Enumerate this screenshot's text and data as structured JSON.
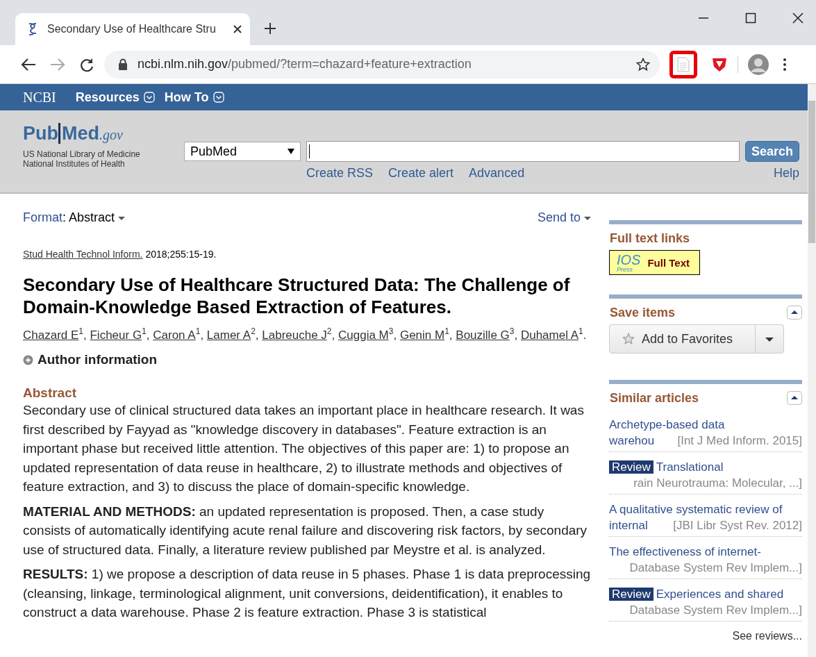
{
  "browser": {
    "tab": {
      "title": "Secondary Use of Healthcare Stru",
      "selected": true
    },
    "url_host": "ncbi.nlm.nih.gov",
    "url_path": "/pubmed/?term=chazard+feature+extraction",
    "extension_highlighted": true
  },
  "ncbi_bar": {
    "logo": "NCBI",
    "menus": [
      "Resources",
      "How To"
    ]
  },
  "header": {
    "logo_pub": "Pub",
    "logo_med": "Med",
    "logo_gov": ".gov",
    "org_lines": [
      "US National Library of Medicine",
      "National Institutes of Health"
    ],
    "database": "PubMed",
    "search_button": "Search",
    "links": [
      "Create RSS",
      "Create alert",
      "Advanced"
    ],
    "help": "Help"
  },
  "format": {
    "label": "Format",
    "separator": ":",
    "value": "Abstract"
  },
  "send_to": "Send to",
  "citation": {
    "journal": "Stud Health Technol Inform.",
    "details": "2018;255:15-19."
  },
  "title": "Secondary Use of Healthcare Structured Data: The Challenge of Domain-Knowledge Based Extraction of Features.",
  "authors": [
    {
      "name": "Chazard E",
      "affil": "1",
      "sep": ","
    },
    {
      "name": "Ficheur G",
      "affil": "1",
      "sep": ","
    },
    {
      "name": "Caron A",
      "affil": "1",
      "sep": ","
    },
    {
      "name": "Lamer A",
      "affil": "2",
      "sep": ","
    },
    {
      "name": "Labreuche J",
      "affil": "2",
      "sep": ","
    },
    {
      "name": "Cuggia M",
      "affil": "3",
      "sep": ","
    },
    {
      "name": "Genin M",
      "affil": "1",
      "sep": ","
    },
    {
      "name": "Bouzille G",
      "affil": "3",
      "sep": ","
    },
    {
      "name": "Duhamel A",
      "affil": "1",
      "sep": "."
    }
  ],
  "author_info": {
    "label": "Author information",
    "expanded": false
  },
  "abstract": {
    "heading": "Abstract",
    "paragraphs": [
      "Secondary use of clinical structured data takes an important place in healthcare research. It was first described by Fayyad as \"knowledge discovery in databases\". Feature extraction is an important phase but received little attention. The objectives of this paper are: 1) to propose an updated representation of data reuse in healthcare, 2) to illustrate methods and objectives of feature extraction, and 3) to discuss the place of domain-specific knowledge.",
      "**MATERIAL AND METHODS:** an updated representation is proposed. Then, a case study consists of automatically identifying acute renal failure and discovering risk factors, by secondary use of structured data. Finally, a literature review published par Meystre et al. is analyzed.",
      "**RESULTS:** 1) we propose a description of data reuse in 5 phases. Phase 1 is data preprocessing (cleansing, linkage, terminological alignment, unit conversions, deidentification), it enables to construct a data warehouse. Phase 2 is feature extraction. Phase 3 is statistical"
    ]
  },
  "sidebar": {
    "full_text": {
      "heading": "Full text links",
      "badge_logo": "IOS",
      "badge_sub": "Press",
      "badge_text": "Full Text"
    },
    "save": {
      "heading": "Save items",
      "button": "Add to Favorites",
      "expanded": true
    },
    "similar": {
      "heading": "Similar articles",
      "expanded": true,
      "items": [
        {
          "review": false,
          "title": "Archetype-based data",
          "title_cont": "warehou",
          "source": "[Int J Med Inform. 2015]"
        },
        {
          "review": true,
          "review_label": "Review",
          "title": "Translational",
          "source": "rain Neurotrauma: Molecular, ...]"
        },
        {
          "review": false,
          "title": "A qualitative systematic review of",
          "title_cont": "internal",
          "source": "[JBI Libr Syst Rev. 2012]"
        },
        {
          "review": false,
          "title": "The effectiveness of internet-",
          "source": "Database System Rev Implem...]"
        },
        {
          "review": true,
          "review_label": "Review",
          "title": "Experiences and shared",
          "source": "Database System Rev Implem...]"
        }
      ],
      "see_reviews": "See reviews..."
    }
  }
}
